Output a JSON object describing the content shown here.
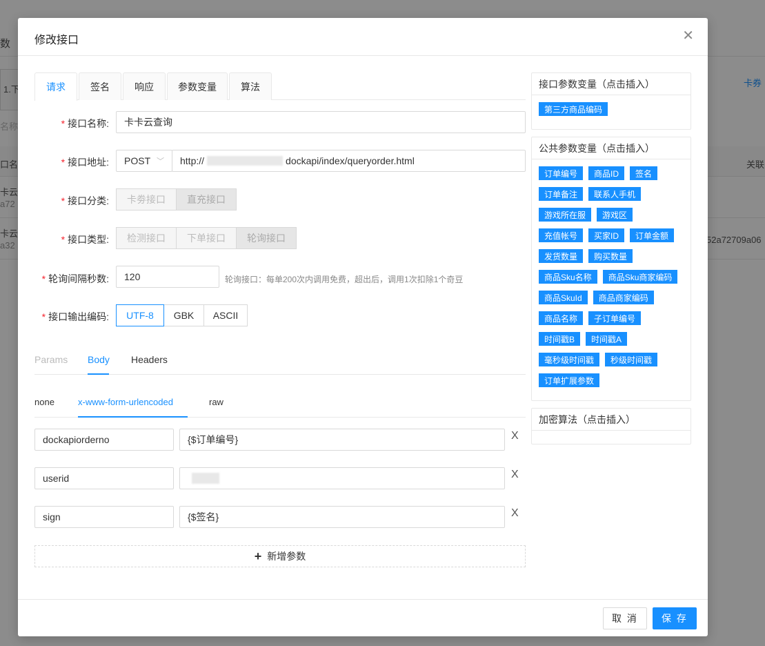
{
  "background": {
    "top_left_text": "数",
    "tab_text": "1.下",
    "search_placeholder": "名称",
    "col_header_left": "口名",
    "col_header_right": "关联",
    "right_link": "卡券",
    "rows": [
      {
        "name": "卡云",
        "id": "a72"
      },
      {
        "name": "卡云",
        "id": "a32",
        "extra": "52a72709a06"
      }
    ]
  },
  "modal": {
    "title": "修改接口",
    "close_icon": "close-icon",
    "tabs": [
      "请求",
      "签名",
      "响应",
      "参数变量",
      "算法"
    ],
    "active_tab": "请求",
    "form": {
      "name": {
        "label": "接口名称:",
        "value": "卡卡云查询"
      },
      "url": {
        "label": "接口地址:",
        "method": "POST",
        "value_prefix": "http://",
        "value_suffix": "dockapi/index/queryorder.html"
      },
      "category": {
        "label": "接口分类:",
        "options": [
          "卡劵接口",
          "直充接口"
        ],
        "selected": "直充接口"
      },
      "type": {
        "label": "接口类型:",
        "options": [
          "检测接口",
          "下单接口",
          "轮询接口"
        ],
        "selected": "轮询接口"
      },
      "interval": {
        "label": "轮询间隔秒数:",
        "value": "120",
        "hint": "轮询接口：每单200次内调用免费，超出后，调用1次扣除1个奇豆"
      },
      "encoding": {
        "label": "接口输出编码:",
        "options": [
          "UTF-8",
          "GBK",
          "ASCII"
        ],
        "selected": "UTF-8"
      }
    },
    "request_tabs": [
      "Params",
      "Body",
      "Headers"
    ],
    "active_request_tab": "Body",
    "body_types": [
      "none",
      "x-www-form-urlencoded",
      "raw"
    ],
    "active_body_type": "x-www-form-urlencoded",
    "params": [
      {
        "key": "dockapiorderno",
        "value": "{$订单编号}"
      },
      {
        "key": "userid",
        "value": ""
      },
      {
        "key": "sign",
        "value": "{$签名}"
      }
    ],
    "delete_label": "X",
    "add_param_label": "新增参数",
    "panels": {
      "interface_vars": {
        "title": "接口参数变量（点击插入）",
        "chips": [
          "第三方商品编码"
        ]
      },
      "public_vars": {
        "title": "公共参数变量（点击插入）",
        "rows": [
          [
            "订单编号",
            "商品ID",
            "签名"
          ],
          [
            "订单备注",
            "联系人手机"
          ],
          [
            "游戏所在服",
            "游戏区"
          ],
          [
            "充值帐号",
            "买家ID",
            "订单金额"
          ],
          [
            "发货数量",
            "购买数量"
          ],
          [
            "商品Sku名称",
            "商品Sku商家编码"
          ],
          [
            "商品SkuId",
            "商品商家编码"
          ],
          [
            "商品名称",
            "子订单编号"
          ],
          [
            "时间戳B",
            "时间戳A"
          ],
          [
            "毫秒级时间戳",
            "秒级时间戳"
          ],
          [
            "订单扩展参数"
          ]
        ]
      },
      "algorithms": {
        "title": "加密算法（点击插入）"
      }
    },
    "footer": {
      "cancel": "取 消",
      "save": "保 存"
    }
  },
  "colors": {
    "primary": "#1890ff",
    "required": "#f5222d"
  }
}
